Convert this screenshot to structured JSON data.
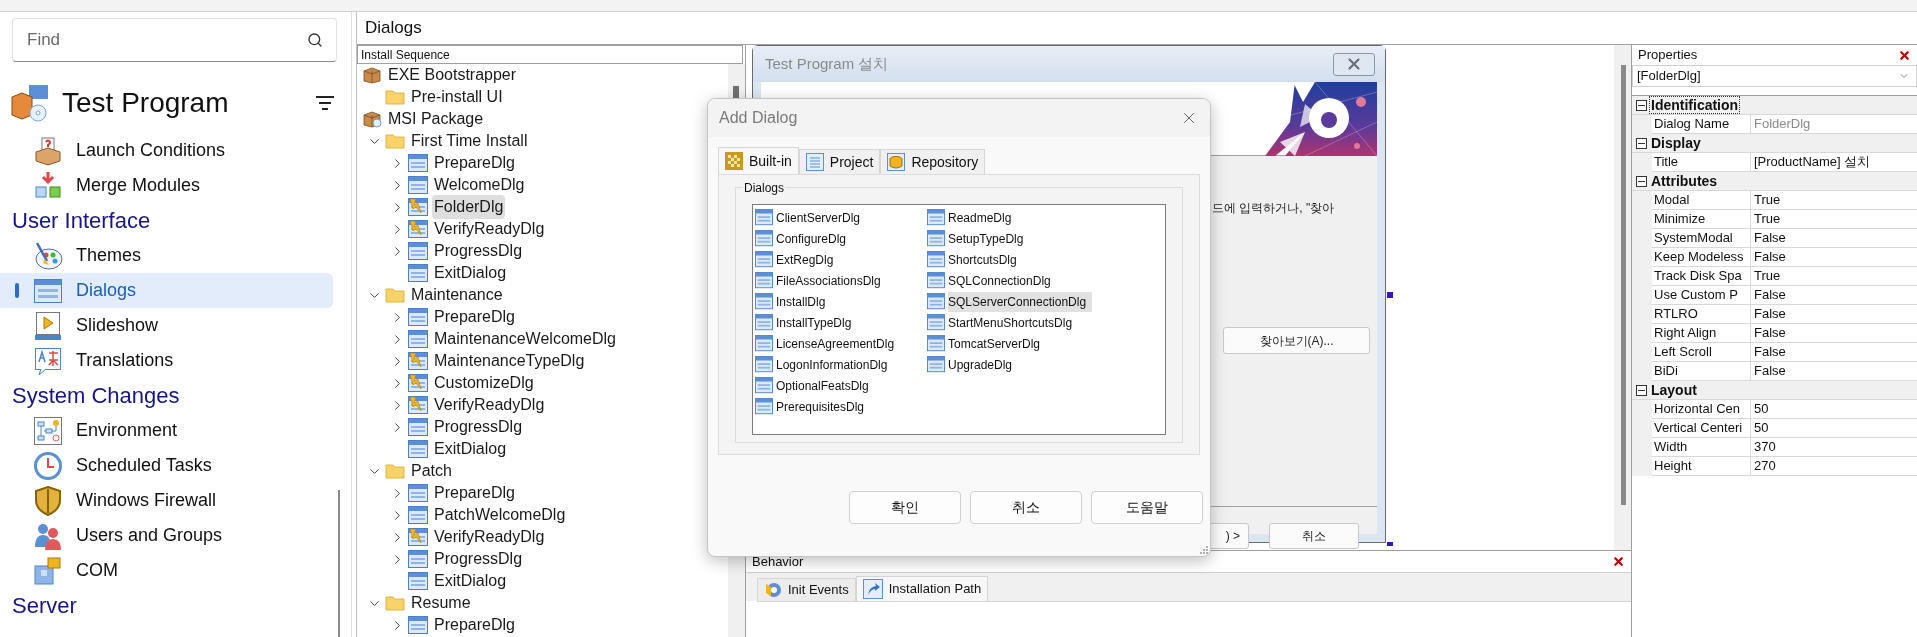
{
  "sidebar": {
    "search": {
      "placeholder": "Find"
    },
    "project": {
      "title": "Test Program"
    },
    "groups": [
      {
        "items": [
          {
            "label": "Launch Conditions",
            "selected": false
          },
          {
            "label": "Merge Modules",
            "selected": false
          }
        ]
      },
      {
        "title": "User Interface",
        "items": [
          {
            "label": "Themes",
            "selected": false
          },
          {
            "label": "Dialogs",
            "selected": true
          },
          {
            "label": "Slideshow",
            "selected": false
          },
          {
            "label": "Translations",
            "selected": false
          }
        ]
      },
      {
        "title": "System Changes",
        "items": [
          {
            "label": "Environment",
            "selected": false
          },
          {
            "label": "Scheduled Tasks",
            "selected": false
          },
          {
            "label": "Windows Firewall",
            "selected": false
          },
          {
            "label": "Users and Groups",
            "selected": false
          },
          {
            "label": "COM",
            "selected": false
          }
        ]
      },
      {
        "title": "Server"
      }
    ]
  },
  "panel_title": "Dialogs",
  "tree": {
    "header": "Install Sequence",
    "items": [
      {
        "label": "EXE Bootstrapper",
        "kind": "package",
        "selected": false,
        "children": [
          {
            "label": "Pre-install UI",
            "kind": "folder",
            "selected": false
          }
        ]
      },
      {
        "label": "MSI Package",
        "kind": "msi",
        "selected": false,
        "children": [
          {
            "label": "First Time Install",
            "kind": "folder",
            "expanded": true,
            "selected": false,
            "children": [
              {
                "label": "PrepareDlg",
                "kind": "dialog",
                "expanded": false,
                "selected": false
              },
              {
                "label": "WelcomeDlg",
                "kind": "dialog",
                "expanded": false,
                "selected": false
              },
              {
                "label": "FolderDlg",
                "kind": "custom",
                "expanded": false,
                "selected": true
              },
              {
                "label": "VerifyReadyDlg",
                "kind": "custom",
                "expanded": false,
                "selected": false
              },
              {
                "label": "ProgressDlg",
                "kind": "dialog",
                "expanded": false,
                "selected": false
              },
              {
                "label": "ExitDialog",
                "kind": "dialog",
                "selected": false
              }
            ]
          },
          {
            "label": "Maintenance",
            "kind": "folder",
            "expanded": true,
            "selected": false,
            "children": [
              {
                "label": "PrepareDlg",
                "kind": "dialog",
                "expanded": false,
                "selected": false
              },
              {
                "label": "MaintenanceWelcomeDlg",
                "kind": "dialog",
                "expanded": false,
                "selected": false
              },
              {
                "label": "MaintenanceTypeDlg",
                "kind": "custom",
                "expanded": false,
                "selected": false
              },
              {
                "label": "CustomizeDlg",
                "kind": "custom",
                "expanded": false,
                "selected": false
              },
              {
                "label": "VerifyReadyDlg",
                "kind": "custom",
                "expanded": false,
                "selected": false
              },
              {
                "label": "ProgressDlg",
                "kind": "dialog",
                "expanded": false,
                "selected": false
              },
              {
                "label": "ExitDialog",
                "kind": "dialog",
                "selected": false
              }
            ]
          },
          {
            "label": "Patch",
            "kind": "folder",
            "expanded": true,
            "selected": false,
            "children": [
              {
                "label": "PrepareDlg",
                "kind": "dialog",
                "expanded": false,
                "selected": false
              },
              {
                "label": "PatchWelcomeDlg",
                "kind": "dialog",
                "expanded": false,
                "selected": false
              },
              {
                "label": "VerifyReadyDlg",
                "kind": "custom",
                "expanded": false,
                "selected": false
              },
              {
                "label": "ProgressDlg",
                "kind": "dialog",
                "expanded": false,
                "selected": false
              },
              {
                "label": "ExitDialog",
                "kind": "dialog",
                "selected": false
              }
            ]
          },
          {
            "label": "Resume",
            "kind": "folder",
            "expanded": true,
            "selected": false,
            "children": [
              {
                "label": "PrepareDlg",
                "kind": "dialog",
                "expanded": false,
                "selected": false
              }
            ]
          }
        ]
      }
    ]
  },
  "preview": {
    "title": "Test Program 설치",
    "text": "드에 입력하거나, \"찾아",
    "browse_button": "찾아보기(A)...",
    "buttons": [
      ") >",
      "취소"
    ]
  },
  "add_dialog": {
    "title": "Add Dialog",
    "tabs": [
      {
        "label": "Built-in",
        "selected": true
      },
      {
        "label": "Project",
        "selected": false
      },
      {
        "label": "Repository",
        "selected": false
      }
    ],
    "group_label": "Dialogs",
    "items": [
      {
        "label": "ClientServerDlg",
        "selected": false
      },
      {
        "label": "ConfigureDlg",
        "selected": false
      },
      {
        "label": "ExtRegDlg",
        "selected": false
      },
      {
        "label": "FileAssociationsDlg",
        "selected": false
      },
      {
        "label": "InstallDlg",
        "selected": false
      },
      {
        "label": "InstallTypeDlg",
        "selected": false
      },
      {
        "label": "LicenseAgreementDlg",
        "selected": false
      },
      {
        "label": "LogonInformationDlg",
        "selected": false
      },
      {
        "label": "OptionalFeatsDlg",
        "selected": false
      },
      {
        "label": "PrerequisitesDlg",
        "selected": false
      },
      {
        "label": "ReadmeDlg",
        "selected": false
      },
      {
        "label": "SetupTypeDlg",
        "selected": false
      },
      {
        "label": "ShortcutsDlg",
        "selected": false
      },
      {
        "label": "SQLConnectionDlg",
        "selected": false
      },
      {
        "label": "SQLServerConnectionDlg",
        "selected": true
      },
      {
        "label": "StartMenuShortcutsDlg",
        "selected": false
      },
      {
        "label": "TomcatServerDlg",
        "selected": false
      },
      {
        "label": "UpgradeDlg",
        "selected": false
      }
    ],
    "buttons": [
      "확인",
      "취소",
      "도움말"
    ]
  },
  "behavior": {
    "title": "Behavior",
    "tabs": [
      {
        "label": "Init Events",
        "selected": false
      },
      {
        "label": "Installation Path",
        "selected": true
      }
    ]
  },
  "properties": {
    "title": "Properties",
    "object": "[FolderDlg]",
    "categories": [
      {
        "name": "Identification",
        "expanded": true,
        "focused": true,
        "rows": [
          {
            "label": "Dialog Name",
            "value": "FolderDlg",
            "readonly": true
          }
        ]
      },
      {
        "name": "Display",
        "expanded": true,
        "focused": false,
        "rows": [
          {
            "label": "Title",
            "value": "[ProductName] 설치",
            "readonly": false
          }
        ]
      },
      {
        "name": "Attributes",
        "expanded": true,
        "focused": false,
        "rows": [
          {
            "label": "Modal",
            "value": "True",
            "readonly": false
          },
          {
            "label": "Minimize",
            "value": "True",
            "readonly": false
          },
          {
            "label": "SystemModal",
            "value": "False",
            "readonly": false
          },
          {
            "label": "Keep Modeless",
            "value": "False",
            "readonly": false
          },
          {
            "label": "Track Disk Spa",
            "value": "True",
            "readonly": false
          },
          {
            "label": "Use Custom P",
            "value": "False",
            "readonly": false
          },
          {
            "label": "RTLRO",
            "value": "False",
            "readonly": false
          },
          {
            "label": "Right Align",
            "value": "False",
            "readonly": false
          },
          {
            "label": "Left Scroll",
            "value": "False",
            "readonly": false
          },
          {
            "label": "BiDi",
            "value": "False",
            "readonly": false
          }
        ]
      },
      {
        "name": "Layout",
        "expanded": true,
        "focused": false,
        "rows": [
          {
            "label": "Horizontal Cen",
            "value": "50",
            "readonly": false
          },
          {
            "label": "Vertical Centeri",
            "value": "50",
            "readonly": false
          },
          {
            "label": "Width",
            "value": "370",
            "readonly": false
          },
          {
            "label": "Height",
            "value": "270",
            "readonly": false
          }
        ]
      }
    ]
  }
}
